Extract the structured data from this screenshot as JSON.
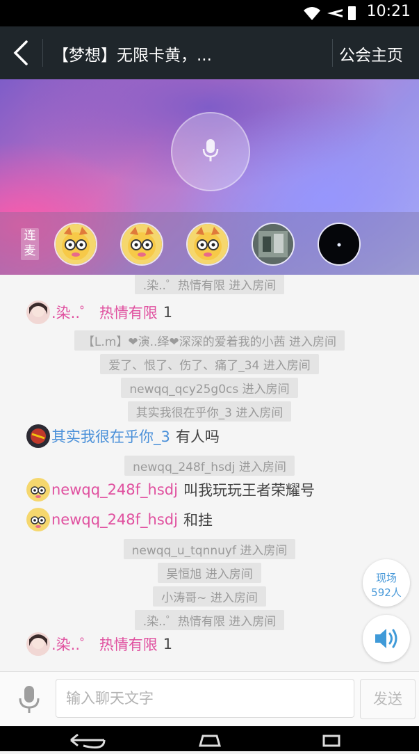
{
  "status": {
    "time": "10:21"
  },
  "header": {
    "title": "【梦想】无限卡黄，...",
    "guild_button": "公会主页"
  },
  "seats": {
    "label": "连麦"
  },
  "chat": {
    "sys_0": ".染..゜热情有限 进入房间",
    "msg_0": {
      "name": ".染..゜ 热情有限",
      "text": "1"
    },
    "sys_1": "【L.m】❤演..绎❤深深的爱着我的小茜 进入房间",
    "sys_2": "爱了、恨了、伤了、痛了_34 进入房间",
    "sys_3": "newqq_qcy25g0cs 进入房间",
    "sys_4": "其实我很在乎你_3 进入房间",
    "msg_1": {
      "name": "其实我很在乎你_3",
      "text": "有人吗"
    },
    "sys_5": "newqq_248f_hsdj 进入房间",
    "msg_2": {
      "name": "newqq_248f_hsdj",
      "text": "叫我玩玩王者荣耀号"
    },
    "msg_3": {
      "name": "newqq_248f_hsdj",
      "text": "和挂"
    },
    "sys_6": "newqq_u_tqnnuyf 进入房间",
    "sys_7": "吴恒旭 进入房间",
    "sys_8": "小涛哥~ 进入房间",
    "sys_9": ".染..゜热情有限 进入房间",
    "msg_4": {
      "name": ".染..゜ 热情有限",
      "text": "1"
    }
  },
  "online": {
    "label": "现场",
    "count": "592人"
  },
  "input": {
    "placeholder": "输入聊天文字",
    "send_label": "发送"
  },
  "colors": {
    "topbar": "#1f262b",
    "name_pink": "#e0509f",
    "name_blue": "#4a90d9",
    "accent_blue": "#4a9ad9"
  }
}
